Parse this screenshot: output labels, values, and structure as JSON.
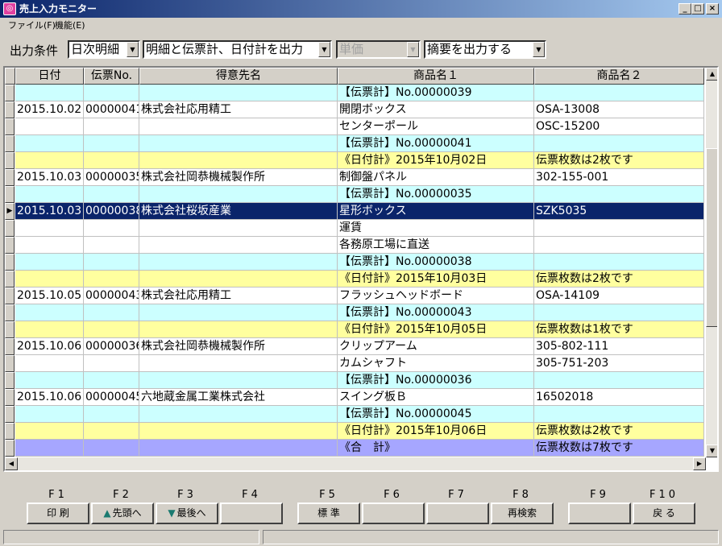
{
  "window": {
    "title": "売上入力モニター",
    "icon": "app-icon"
  },
  "menu": [
    {
      "label": "ファイル(F)"
    },
    {
      "label": "機能(E)"
    }
  ],
  "conditions": {
    "label": "出力条件",
    "combo1": "日次明細",
    "combo2": "明細と伝票計、日付計を出力",
    "combo3": "単価",
    "combo4": "摘要を出力する"
  },
  "grid": {
    "columns": [
      "日付",
      "伝票No.",
      "得意先名",
      "商品名１",
      "商品名２"
    ],
    "rows": [
      {
        "type": "cyan",
        "c1": "",
        "c2": "",
        "c3": "",
        "c4": "【伝票計】No.00000039",
        "c5": ""
      },
      {
        "type": "white",
        "c1": "2015.10.02",
        "c2": "00000041",
        "c3": "株式会社応用精工",
        "c4": "開閉ボックス",
        "c5": "OSA-13008"
      },
      {
        "type": "white",
        "c1": "",
        "c2": "",
        "c3": "",
        "c4": "センターポール",
        "c5": "OSC-15200"
      },
      {
        "type": "cyan",
        "c1": "",
        "c2": "",
        "c3": "",
        "c4": "【伝票計】No.00000041",
        "c5": ""
      },
      {
        "type": "yellow",
        "c1": "",
        "c2": "",
        "c3": "",
        "c4": "《日付計》2015年10月02日",
        "c5": "伝票枚数は2枚です"
      },
      {
        "type": "white",
        "c1": "2015.10.03",
        "c2": "00000035",
        "c3": "株式会社岡恭機械製作所",
        "c4": "制御盤パネル",
        "c5": "302-155-001"
      },
      {
        "type": "cyan",
        "c1": "",
        "c2": "",
        "c3": "",
        "c4": "【伝票計】No.00000035",
        "c5": ""
      },
      {
        "type": "sel",
        "c1": "2015.10.03",
        "c2": "00000038",
        "c3": "株式会社桜坂産業",
        "c4": "星形ボックス",
        "c5": "SZK5035"
      },
      {
        "type": "white",
        "c1": "",
        "c2": "",
        "c3": "",
        "c4": "運賃",
        "c5": ""
      },
      {
        "type": "white",
        "c1": "",
        "c2": "",
        "c3": "",
        "c4": "各務原工場に直送",
        "c5": ""
      },
      {
        "type": "cyan",
        "c1": "",
        "c2": "",
        "c3": "",
        "c4": "【伝票計】No.00000038",
        "c5": ""
      },
      {
        "type": "yellow",
        "c1": "",
        "c2": "",
        "c3": "",
        "c4": "《日付計》2015年10月03日",
        "c5": "伝票枚数は2枚です"
      },
      {
        "type": "white",
        "c1": "2015.10.05",
        "c2": "00000043",
        "c3": "株式会社応用精工",
        "c4": "フラッシュヘッドボード",
        "c5": "OSA-14109"
      },
      {
        "type": "cyan",
        "c1": "",
        "c2": "",
        "c3": "",
        "c4": "【伝票計】No.00000043",
        "c5": ""
      },
      {
        "type": "yellow",
        "c1": "",
        "c2": "",
        "c3": "",
        "c4": "《日付計》2015年10月05日",
        "c5": "伝票枚数は1枚です"
      },
      {
        "type": "white",
        "c1": "2015.10.06",
        "c2": "00000036",
        "c3": "株式会社岡恭機械製作所",
        "c4": "クリップアーム",
        "c5": "305-802-111"
      },
      {
        "type": "white",
        "c1": "",
        "c2": "",
        "c3": "",
        "c4": "カムシャフト",
        "c5": "305-751-203"
      },
      {
        "type": "cyan",
        "c1": "",
        "c2": "",
        "c3": "",
        "c4": "【伝票計】No.00000036",
        "c5": ""
      },
      {
        "type": "white",
        "c1": "2015.10.06",
        "c2": "00000045",
        "c3": "六地蔵金属工業株式会社",
        "c4": "スイング板Ｂ",
        "c5": "16502018"
      },
      {
        "type": "cyan",
        "c1": "",
        "c2": "",
        "c3": "",
        "c4": "【伝票計】No.00000045",
        "c5": ""
      },
      {
        "type": "yellow",
        "c1": "",
        "c2": "",
        "c3": "",
        "c4": "《日付計》2015年10月06日",
        "c5": "伝票枚数は2枚です"
      },
      {
        "type": "violet",
        "c1": "",
        "c2": "",
        "c3": "",
        "c4": "《合　計》",
        "c5": "伝票枚数は7枚です"
      }
    ]
  },
  "fkeys": [
    {
      "key": "F1",
      "label": "印 刷",
      "icon": ""
    },
    {
      "key": "F2",
      "label": "先頭へ",
      "icon": "arrow-up-icon"
    },
    {
      "key": "F3",
      "label": "最後へ",
      "icon": "arrow-down-icon"
    },
    {
      "key": "F4",
      "label": "",
      "icon": ""
    },
    {
      "key": "F5",
      "label": "標 準",
      "icon": ""
    },
    {
      "key": "F6",
      "label": "",
      "icon": ""
    },
    {
      "key": "F7",
      "label": "",
      "icon": ""
    },
    {
      "key": "F8",
      "label": "再検索",
      "icon": ""
    },
    {
      "key": "F9",
      "label": "",
      "icon": ""
    },
    {
      "key": "F10",
      "label": "戻 る",
      "icon": ""
    }
  ],
  "colors": {
    "cyan": "#ccffff",
    "yellow": "#ffff9f",
    "violet": "#a6a6ff",
    "selected": "#0a246a"
  }
}
